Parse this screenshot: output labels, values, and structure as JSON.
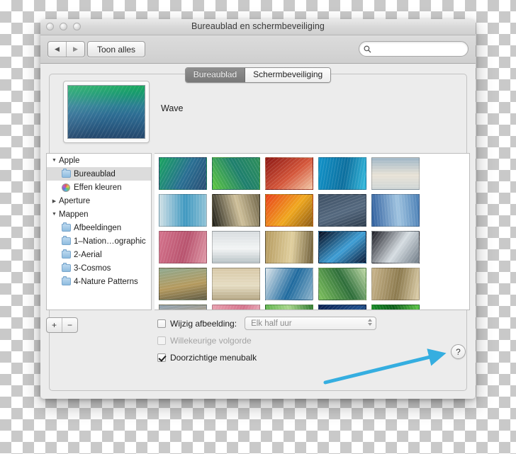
{
  "window": {
    "title": "Bureaublad en schermbeveiliging",
    "traffic_lights": [
      "close-button",
      "minimize-button",
      "zoom-button"
    ]
  },
  "toolbar": {
    "back_label": "◀",
    "forward_label": "▶",
    "show_all_label": "Toon alles",
    "search": {
      "value": "",
      "placeholder": "",
      "icon": "search-icon"
    }
  },
  "tabs": [
    {
      "label": "Bureaublad",
      "selected": true
    },
    {
      "label": "Schermbeveiliging",
      "selected": false
    }
  ],
  "preview": {
    "name": "Wave"
  },
  "sidebar": {
    "items": [
      {
        "label": "Apple",
        "icon": "disclosure-open",
        "indent": 0,
        "selected": false
      },
      {
        "label": "Bureaublad",
        "icon": "folder-icon",
        "indent": 1,
        "selected": true
      },
      {
        "label": "Effen kleuren",
        "icon": "color-wheel-icon",
        "indent": 1,
        "selected": false
      },
      {
        "label": "Aperture",
        "icon": "disclosure-closed",
        "indent": 0,
        "selected": false
      },
      {
        "label": "Mappen",
        "icon": "disclosure-open",
        "indent": 0,
        "selected": false
      },
      {
        "label": "Afbeeldingen",
        "icon": "folder-icon",
        "indent": 1,
        "selected": false
      },
      {
        "label": "1–Nation…ographic",
        "icon": "folder-icon",
        "indent": 1,
        "selected": false
      },
      {
        "label": "2-Aerial",
        "icon": "folder-icon",
        "indent": 1,
        "selected": false
      },
      {
        "label": "3-Cosmos",
        "icon": "folder-icon",
        "indent": 1,
        "selected": false
      },
      {
        "label": "4-Nature Patterns",
        "icon": "folder-icon",
        "indent": 1,
        "selected": false
      }
    ],
    "add_label": "+",
    "remove_label": "−"
  },
  "thumbnails": {
    "rows": [
      [
        {
          "name": "wave",
          "c1": "#19a45f",
          "c2": "#2a6f93",
          "c3": "#2b4e74",
          "angle": "118deg"
        },
        {
          "name": "green-swirl",
          "c1": "#5ec840",
          "c2": "#1e7f6e",
          "c3": "#2e8f5a",
          "angle": "60deg"
        },
        {
          "name": "red-canyon",
          "c1": "#8c1714",
          "c2": "#d4563a",
          "c3": "#f2c9a8",
          "angle": "140deg"
        },
        {
          "name": "blue-water",
          "c1": "#1293c9",
          "c2": "#0d6f9e",
          "c3": "#37bde0",
          "angle": "100deg"
        },
        {
          "name": "pale-shore",
          "c1": "#9fb6c6",
          "c2": "#e8e2d6",
          "c3": "#cfd6d6",
          "angle": "180deg"
        }
      ],
      [
        {
          "name": "blue-reeds",
          "c1": "#cfe0e6",
          "c2": "#3f98c0",
          "c3": "#8fc2d6",
          "angle": "90deg"
        },
        {
          "name": "dark-grass",
          "c1": "#1b1b14",
          "c2": "#cfc09a",
          "c3": "#6e6448",
          "angle": "75deg"
        },
        {
          "name": "orange-leaf",
          "c1": "#e8411c",
          "c2": "#f0a81f",
          "c3": "#8c5a14",
          "angle": "130deg"
        },
        {
          "name": "blue-slate",
          "c1": "#3d4f63",
          "c2": "#55697f",
          "c3": "#2e3d4e",
          "angle": "160deg"
        },
        {
          "name": "blue-ice",
          "c1": "#2f5f9e",
          "c2": "#9fc3e0",
          "c3": "#4a7fb5",
          "angle": "85deg"
        }
      ],
      [
        {
          "name": "pink-dunes",
          "c1": "#d4738c",
          "c2": "#b8536e",
          "c3": "#e09aa8",
          "angle": "105deg"
        },
        {
          "name": "misty-lake",
          "c1": "#d8dde0",
          "c2": "#f2f4f4",
          "c3": "#b8c2c6",
          "angle": "180deg"
        },
        {
          "name": "sand-cliff",
          "c1": "#b59a5e",
          "c2": "#e0cf9e",
          "c3": "#6e5e3a",
          "angle": "95deg"
        },
        {
          "name": "earth-space",
          "c1": "#05091c",
          "c2": "#3f9fd6",
          "c3": "#0a1733",
          "angle": "140deg"
        },
        {
          "name": "ice-ridge",
          "c1": "#1a1a22",
          "c2": "#d6dde2",
          "c3": "#6e7a85",
          "angle": "125deg"
        }
      ],
      [
        {
          "name": "elephant",
          "c1": "#8ea88f",
          "c2": "#b59a5e",
          "c3": "#5e5a44",
          "angle": "170deg"
        },
        {
          "name": "desert-herd",
          "c1": "#d8c9a8",
          "c2": "#e5dcc2",
          "c3": "#b5a684",
          "angle": "180deg"
        },
        {
          "name": "river-delta",
          "c1": "#dfe7ec",
          "c2": "#1f6a9e",
          "c3": "#8fb5cc",
          "angle": "115deg"
        },
        {
          "name": "lily-pads",
          "c1": "#7fc25e",
          "c2": "#2e6e3a",
          "c3": "#c2dca8",
          "angle": "60deg"
        },
        {
          "name": "dry-grass",
          "c1": "#c9b58c",
          "c2": "#8c7a4e",
          "c3": "#e0d2ae",
          "angle": "100deg"
        }
      ],
      [
        {
          "name": "savanna",
          "c1": "#8fa3b5",
          "c2": "#b59a6e",
          "c3": "#6e7a5e",
          "angle": "170deg"
        },
        {
          "name": "pink-feather",
          "c1": "#e8a0ae",
          "c2": "#d4738c",
          "c3": "#f2c2cc",
          "angle": "110deg"
        },
        {
          "name": "green-ripple",
          "c1": "#4aa83a",
          "c2": "#a8d68c",
          "c3": "#2e7a2e",
          "angle": "75deg"
        },
        {
          "name": "night-blue",
          "c1": "#0a1e4e",
          "c2": "#1f4f8c",
          "c3": "#050d26",
          "angle": "135deg"
        },
        {
          "name": "green-blades",
          "c1": "#1a9e2e",
          "c2": "#0d5e1a",
          "c3": "#5ec84a",
          "angle": "70deg"
        }
      ]
    ]
  },
  "options": {
    "change_picture": {
      "label": "Wijzig afbeelding:",
      "checked": false
    },
    "interval": {
      "value": "Elk half uur"
    },
    "random_order": {
      "label": "Willekeurige volgorde",
      "checked": false,
      "disabled": true
    },
    "translucent_menubar": {
      "label": "Doorzichtige menubalk",
      "checked": true
    }
  },
  "help": {
    "label": "?"
  },
  "annotation": {
    "arrow_color": "#35aee0"
  }
}
